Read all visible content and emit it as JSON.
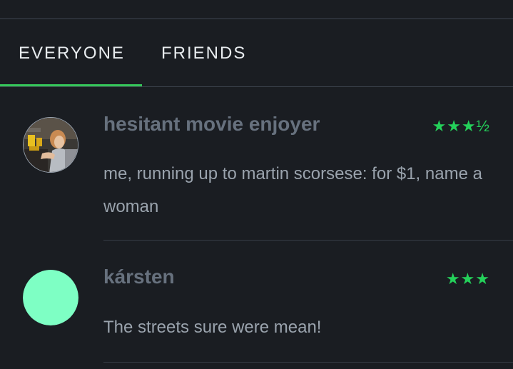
{
  "tabs": [
    {
      "label": "EVERYONE",
      "active": true
    },
    {
      "label": "FRIENDS",
      "active": false
    }
  ],
  "accent_color": "#35c75a",
  "reviews": [
    {
      "username": "hesitant movie enjoyer",
      "rating_display": "★★★½",
      "rating": 3.5,
      "text": "me, running up to martin scorsese: for $1, name a woman",
      "avatar": {
        "type": "photo",
        "icon": "user-photo-avatar"
      }
    },
    {
      "username": "kársten",
      "rating_display": "★★★",
      "rating": 3,
      "text": "The streets sure were mean!",
      "avatar": {
        "type": "solid",
        "color": "#7effc4",
        "icon": "user-default-avatar"
      }
    }
  ]
}
